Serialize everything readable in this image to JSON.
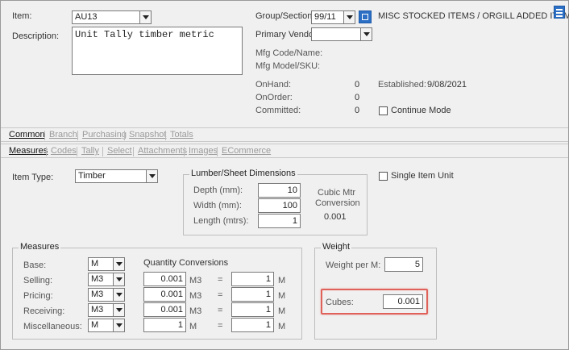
{
  "header": {
    "item_label": "Item:",
    "item_value": "AU13",
    "description_label": "Description:",
    "description_value": "Unit Tally timber metric",
    "group_label": "Group/Section:",
    "group_value": "99/11",
    "group_desc": "MISC STOCKED ITEMS / ORGILL ADDED ITEMS",
    "vendor_label": "Primary Vendor:",
    "vendor_value": "",
    "mfg_code_label": "Mfg Code/Name:",
    "mfg_model_label": "Mfg Model/SKU:",
    "onhand_label": "OnHand:",
    "onhand_value": "0",
    "onorder_label": "OnOrder:",
    "onorder_value": "0",
    "committed_label": "Committed:",
    "committed_value": "0",
    "established_label": "Established:",
    "established_value": "9/08/2021",
    "continue_mode_label": "Continue Mode"
  },
  "main_tabs": [
    "Common",
    "Branch",
    "Purchasing",
    "Snapshot",
    "Totals"
  ],
  "sub_tabs": [
    "Measures",
    "Codes",
    "Tally",
    "Select",
    "Attachments",
    "Images",
    "ECommerce"
  ],
  "item_type": {
    "label": "Item Type:",
    "value": "Timber"
  },
  "single_item_unit_label": "Single Item Unit",
  "lumber": {
    "title": "Lumber/Sheet Dimensions",
    "depth_label": "Depth (mm):",
    "depth_value": "10",
    "width_label": "Width   (mm):",
    "width_value": "100",
    "length_label": "Length (mtrs):",
    "length_value": "1",
    "conversion_label_1": "Cubic Mtr",
    "conversion_label_2": "Conversion",
    "conversion_value": "0.001"
  },
  "measures": {
    "title": "Measures",
    "quantity_conversions_label": "Quantity Conversions",
    "rows": [
      {
        "label": "Base:",
        "unit": "M"
      },
      {
        "label": "Selling:",
        "unit": "M3",
        "qty": "0.001",
        "qty_unit": "M3",
        "eq": "=",
        "conv": "1",
        "conv_unit": "M"
      },
      {
        "label": "Pricing:",
        "unit": "M3",
        "qty": "0.001",
        "qty_unit": "M3",
        "eq": "=",
        "conv": "1",
        "conv_unit": "M"
      },
      {
        "label": "Receiving:",
        "unit": "M3",
        "qty": "0.001",
        "qty_unit": "M3",
        "eq": "=",
        "conv": "1",
        "conv_unit": "M"
      },
      {
        "label": "Miscellaneous:",
        "unit": "M",
        "qty": "1",
        "qty_unit": "M",
        "eq": "=",
        "conv": "1",
        "conv_unit": "M"
      }
    ]
  },
  "weight": {
    "title": "Weight",
    "weight_per_label": "Weight per M:",
    "weight_per_value": "5",
    "cubes_label": "Cubes:",
    "cubes_value": "0.001"
  },
  "colors": {
    "highlight": "#e0605a",
    "menu_icon": "#1e5aa8"
  },
  "icons": {
    "menu": "menu-icon",
    "group_lookup": "lookup-icon"
  }
}
